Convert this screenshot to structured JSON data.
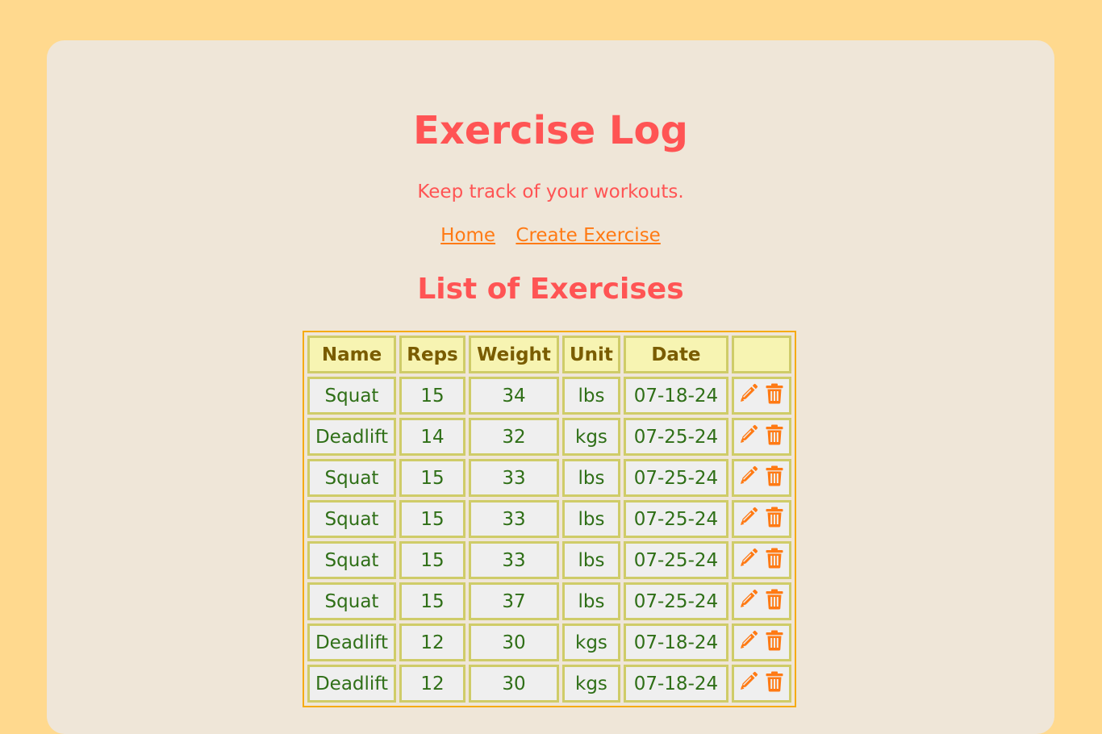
{
  "header": {
    "title": "Exercise Log",
    "subtitle": "Keep track of your workouts."
  },
  "nav": {
    "links": [
      {
        "label": "Home"
      },
      {
        "label": "Create Exercise"
      }
    ]
  },
  "main": {
    "section_title": "List of Exercises",
    "table": {
      "columns": [
        "Name",
        "Reps",
        "Weight",
        "Unit",
        "Date",
        ""
      ],
      "rows": [
        {
          "name": "Squat",
          "reps": "15",
          "weight": "34",
          "unit": "lbs",
          "date": "07-18-24"
        },
        {
          "name": "Deadlift",
          "reps": "14",
          "weight": "32",
          "unit": "kgs",
          "date": "07-25-24"
        },
        {
          "name": "Squat",
          "reps": "15",
          "weight": "33",
          "unit": "lbs",
          "date": "07-25-24"
        },
        {
          "name": "Squat",
          "reps": "15",
          "weight": "33",
          "unit": "lbs",
          "date": "07-25-24"
        },
        {
          "name": "Squat",
          "reps": "15",
          "weight": "33",
          "unit": "lbs",
          "date": "07-25-24"
        },
        {
          "name": "Squat",
          "reps": "15",
          "weight": "37",
          "unit": "lbs",
          "date": "07-25-24"
        },
        {
          "name": "Deadlift",
          "reps": "12",
          "weight": "30",
          "unit": "kgs",
          "date": "07-18-24"
        },
        {
          "name": "Deadlift",
          "reps": "12",
          "weight": "30",
          "unit": "kgs",
          "date": "07-18-24"
        }
      ],
      "row_actions": [
        "pencil-icon",
        "trash-icon"
      ]
    }
  },
  "colors": {
    "page_background": "#ffd98e",
    "card_background": "#efe6d8",
    "heading": "#ff5454",
    "link": "#ff7a14",
    "table_border": "#f5ab15",
    "cell_border": "#cfcc68",
    "header_cell_bg": "#f7f4b2",
    "header_text": "#7a5c00",
    "cell_text": "#2f6f17",
    "icon": "#ff7a14"
  }
}
